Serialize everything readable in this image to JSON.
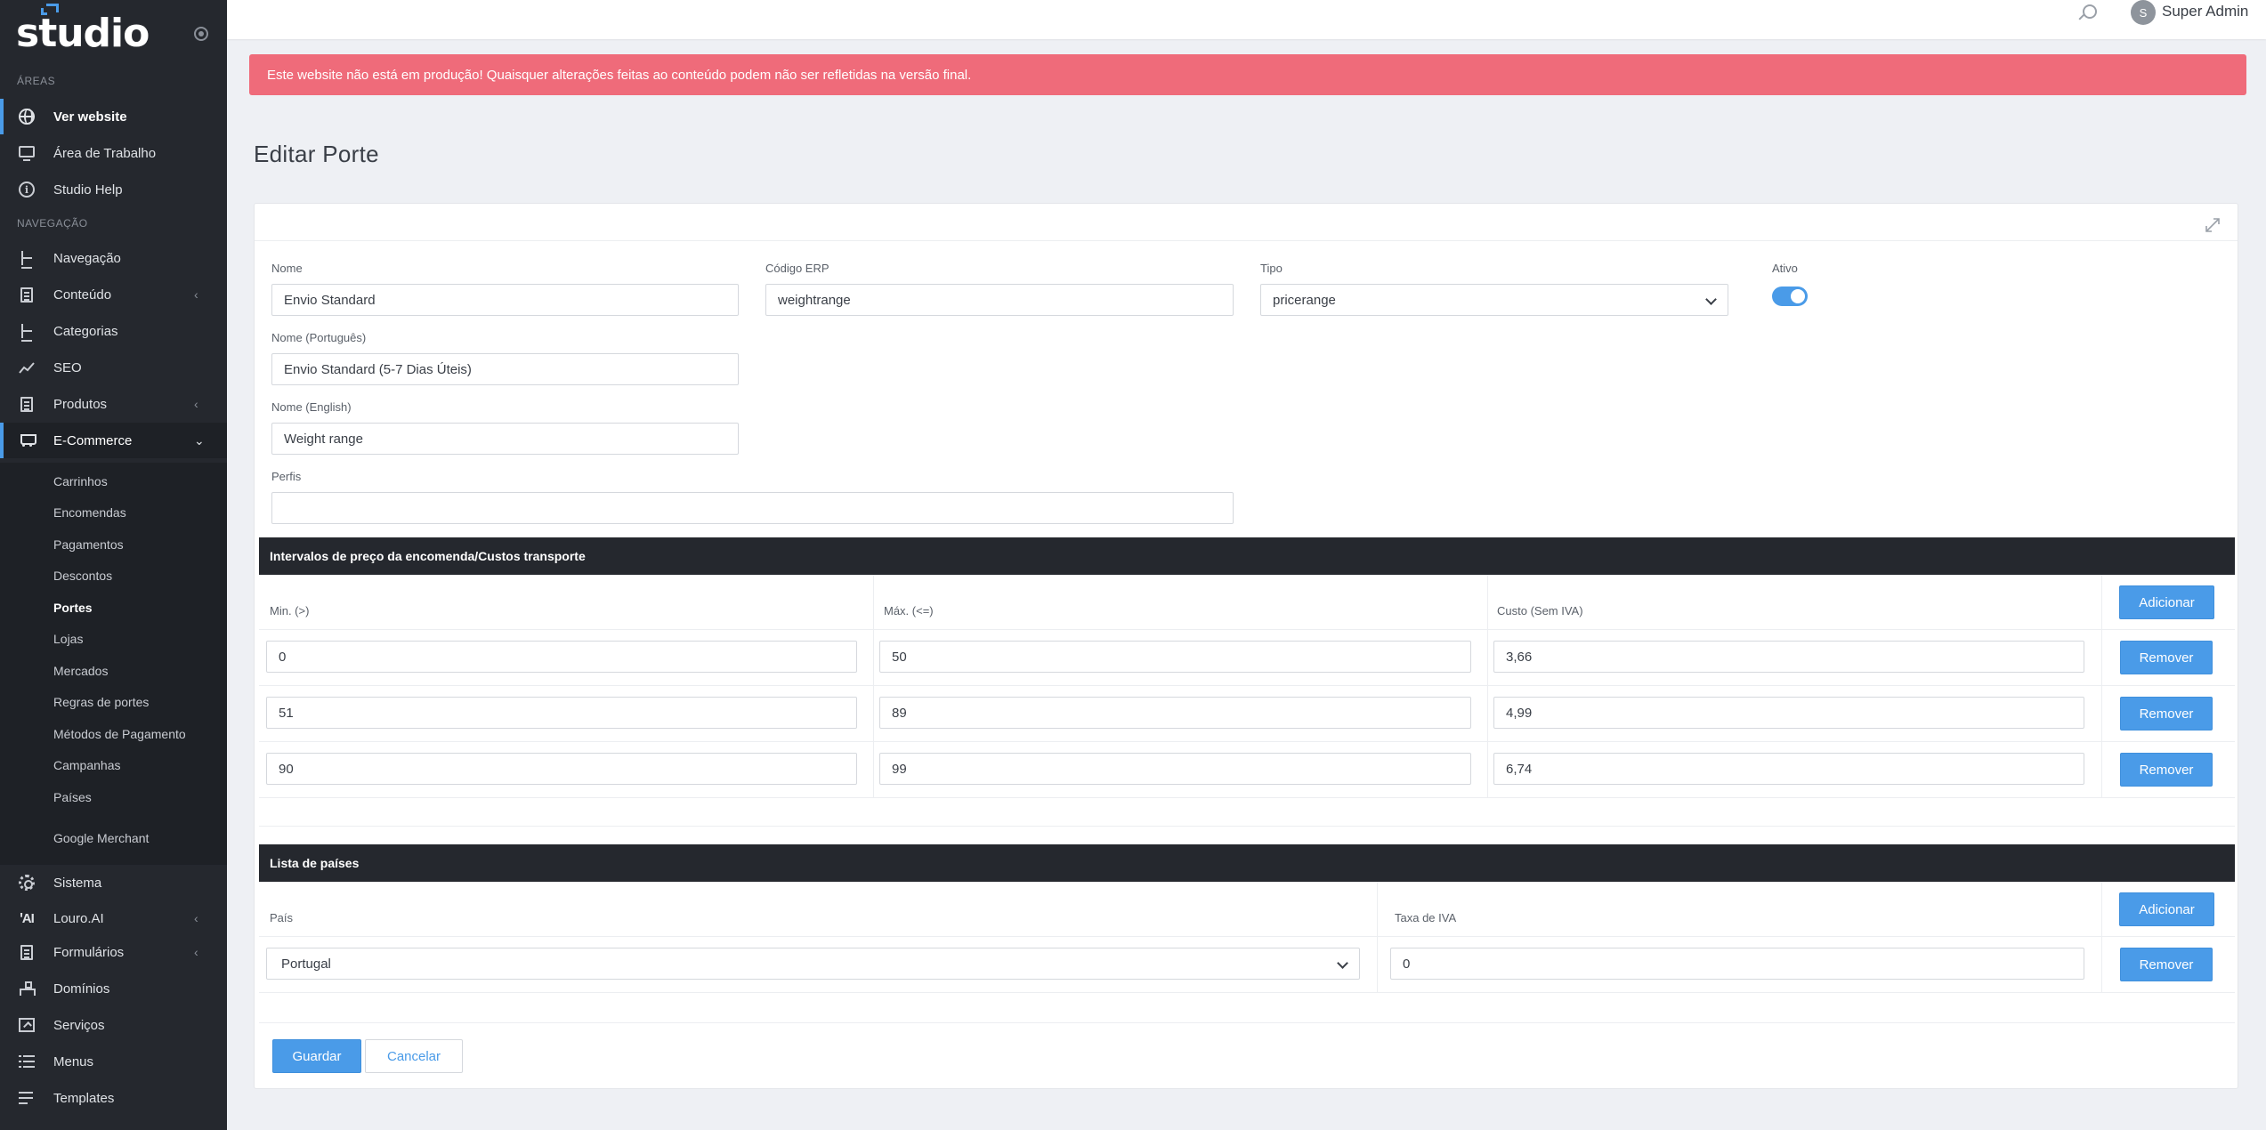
{
  "app": {
    "logo": "studio"
  },
  "sidebar": {
    "section_areas": "ÁREAS",
    "section_nav": "NAVEGAÇÃO",
    "areas": [
      {
        "label": "Ver website",
        "icon": "globe-icon"
      },
      {
        "label": "Área de Trabalho",
        "icon": "monitor-icon"
      },
      {
        "label": "Studio Help",
        "icon": "info-icon"
      }
    ],
    "nav": [
      {
        "label": "Navegação",
        "icon": "sitemap-tree-icon"
      },
      {
        "label": "Conteúdo",
        "icon": "document-icon"
      },
      {
        "label": "Categorias",
        "icon": "tree-icon"
      },
      {
        "label": "SEO",
        "icon": "line-chart-icon"
      },
      {
        "label": "Produtos",
        "icon": "document-icon"
      },
      {
        "label": "E-Commerce",
        "icon": "cart-icon"
      }
    ],
    "ecommerce_sub": [
      "Carrinhos",
      "Encomendas",
      "Pagamentos",
      "Descontos",
      "Portes",
      "Lojas",
      "Mercados",
      "Regras de portes",
      "Métodos de Pagamento",
      "Campanhas",
      "Países",
      "Google Merchant"
    ],
    "bottom": [
      {
        "label": "Sistema",
        "icon": "gear-icon"
      },
      {
        "label": "Louro.AI",
        "icon": "ai-icon"
      },
      {
        "label": "Formulários",
        "icon": "document-icon"
      },
      {
        "label": "Domínios",
        "icon": "sitemap-icon"
      },
      {
        "label": "Serviços",
        "icon": "service-icon"
      },
      {
        "label": "Menus",
        "icon": "list-icon"
      },
      {
        "label": "Templates",
        "icon": "align-icon"
      }
    ]
  },
  "topbar": {
    "avatar_initial": "S",
    "username": "Super Admin"
  },
  "alert": {
    "text": "Este website não está em produção! Quaisquer alterações feitas ao conteúdo podem não ser refletidas na versão final."
  },
  "page": {
    "title": "Editar Porte"
  },
  "form": {
    "nome_label": "Nome",
    "nome_value": "Envio Standard",
    "erp_label": "Código ERP",
    "erp_value": "weightrange",
    "tipo_label": "Tipo",
    "tipo_value": "pricerange",
    "ativo_label": "Ativo",
    "ativo_on": true,
    "nome_pt_label": "Nome (Português)",
    "nome_pt_value": "Envio Standard (5-7 Dias Úteis)",
    "nome_en_label": "Nome (English)",
    "nome_en_value": "Weight range",
    "perfis_label": "Perfis",
    "perfis_value": ""
  },
  "ranges": {
    "title": "Intervalos de preço da encomenda/Custos transporte",
    "col_min": "Min. (>)",
    "col_max": "Máx. (<=)",
    "col_cost": "Custo (Sem IVA)",
    "add_label": "Adicionar",
    "remove_label": "Remover",
    "rows": [
      {
        "min": "0",
        "max": "50",
        "cost": "3,66"
      },
      {
        "min": "51",
        "max": "89",
        "cost": "4,99"
      },
      {
        "min": "90",
        "max": "99",
        "cost": "6,74"
      }
    ]
  },
  "countries": {
    "title": "Lista de países",
    "col_country": "País",
    "col_tax": "Taxa de IVA",
    "add_label": "Adicionar",
    "remove_label": "Remover",
    "rows": [
      {
        "country": "Portugal",
        "tax": "0"
      }
    ]
  },
  "actions": {
    "save": "Guardar",
    "cancel": "Cancelar"
  }
}
